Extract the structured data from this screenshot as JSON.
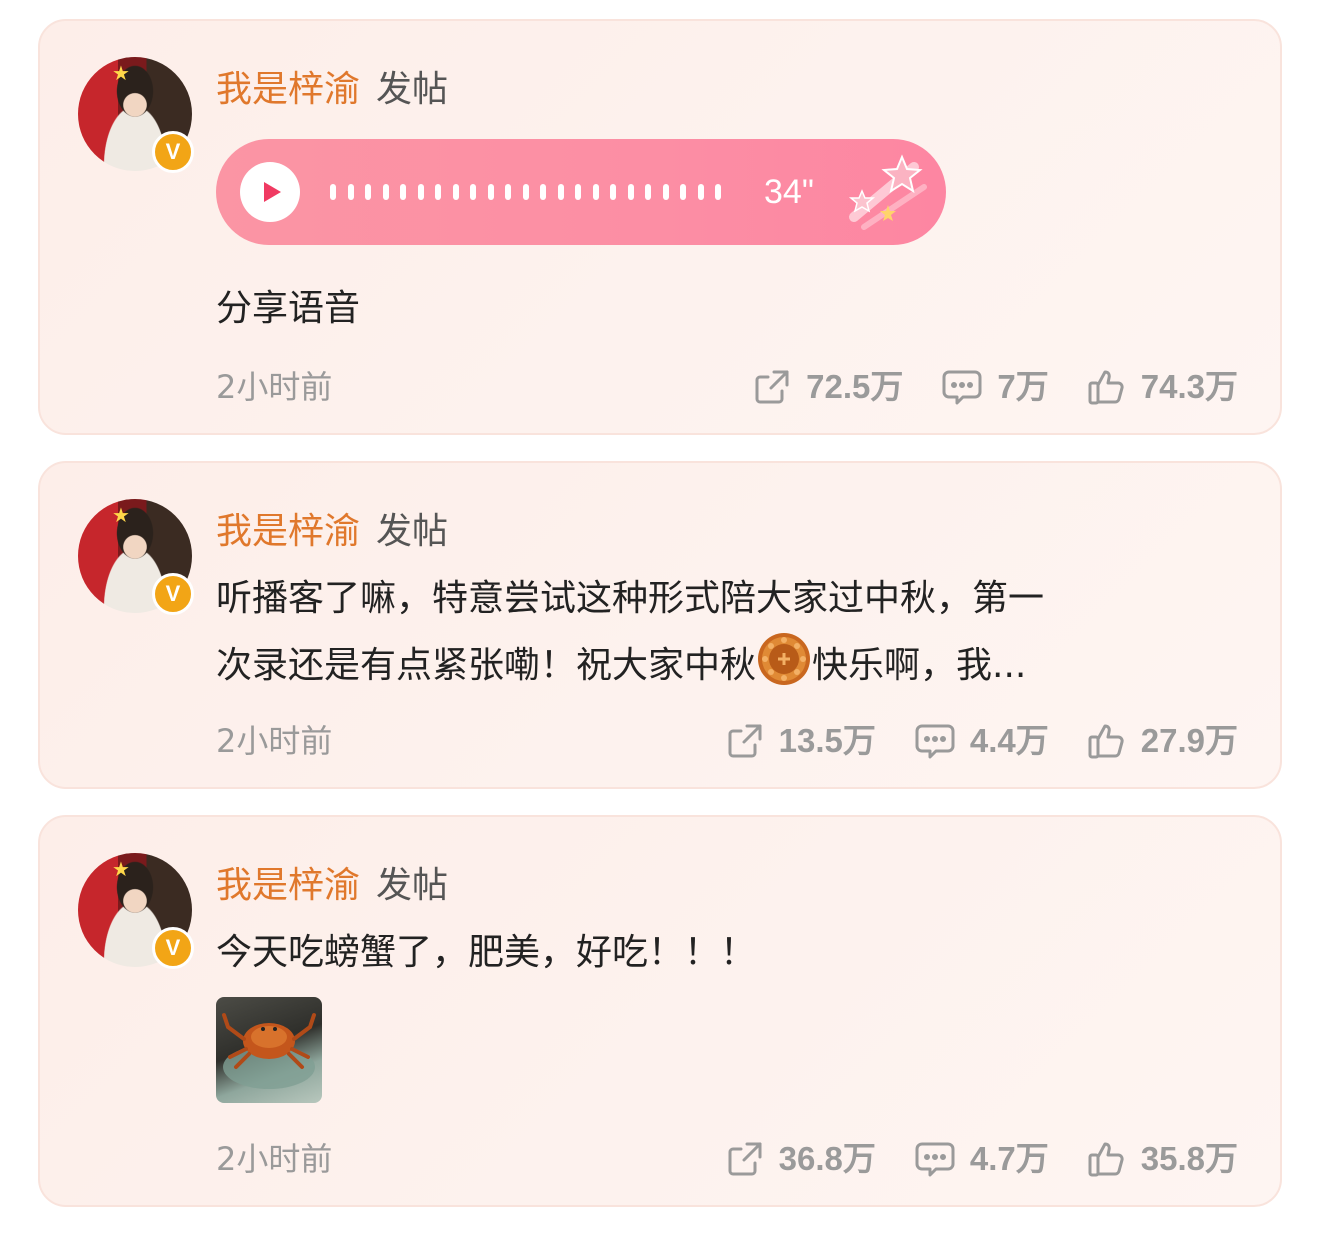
{
  "posts": [
    {
      "author": "我是梓渝",
      "action": "发帖",
      "voice_duration": "34\"",
      "text": "分享语音",
      "time": "2小时前",
      "reposts": "72.5万",
      "comments": "7万",
      "likes": "74.3万"
    },
    {
      "author": "我是梓渝",
      "action": "发帖",
      "text_line1": "听播客了嘛，特意尝试这种形式陪大家过中秋，第一",
      "text_line2a": "次录还是有点紧张嘞！祝大家中秋",
      "text_line2b": "快乐啊，我...",
      "time": "2小时前",
      "reposts": "13.5万",
      "comments": "4.4万",
      "likes": "27.9万"
    },
    {
      "author": "我是梓渝",
      "action": "发帖",
      "text": "今天吃螃蟹了，肥美，好吃！！！",
      "time": "2小时前",
      "reposts": "36.8万",
      "comments": "4.7万",
      "likes": "35.8万"
    }
  ],
  "icons": {
    "verified": "verified-v-badge-icon",
    "repost": "share-arrow-icon",
    "comment": "comment-bubble-icon",
    "like": "thumbs-up-icon",
    "play": "play-icon",
    "emoji": "mooncake-emoji-icon"
  },
  "colors": {
    "author": "#e0782c",
    "voice_bar": "#fc8ea4",
    "verified_badge": "#f2a516",
    "meta": "#9a9a9a"
  }
}
